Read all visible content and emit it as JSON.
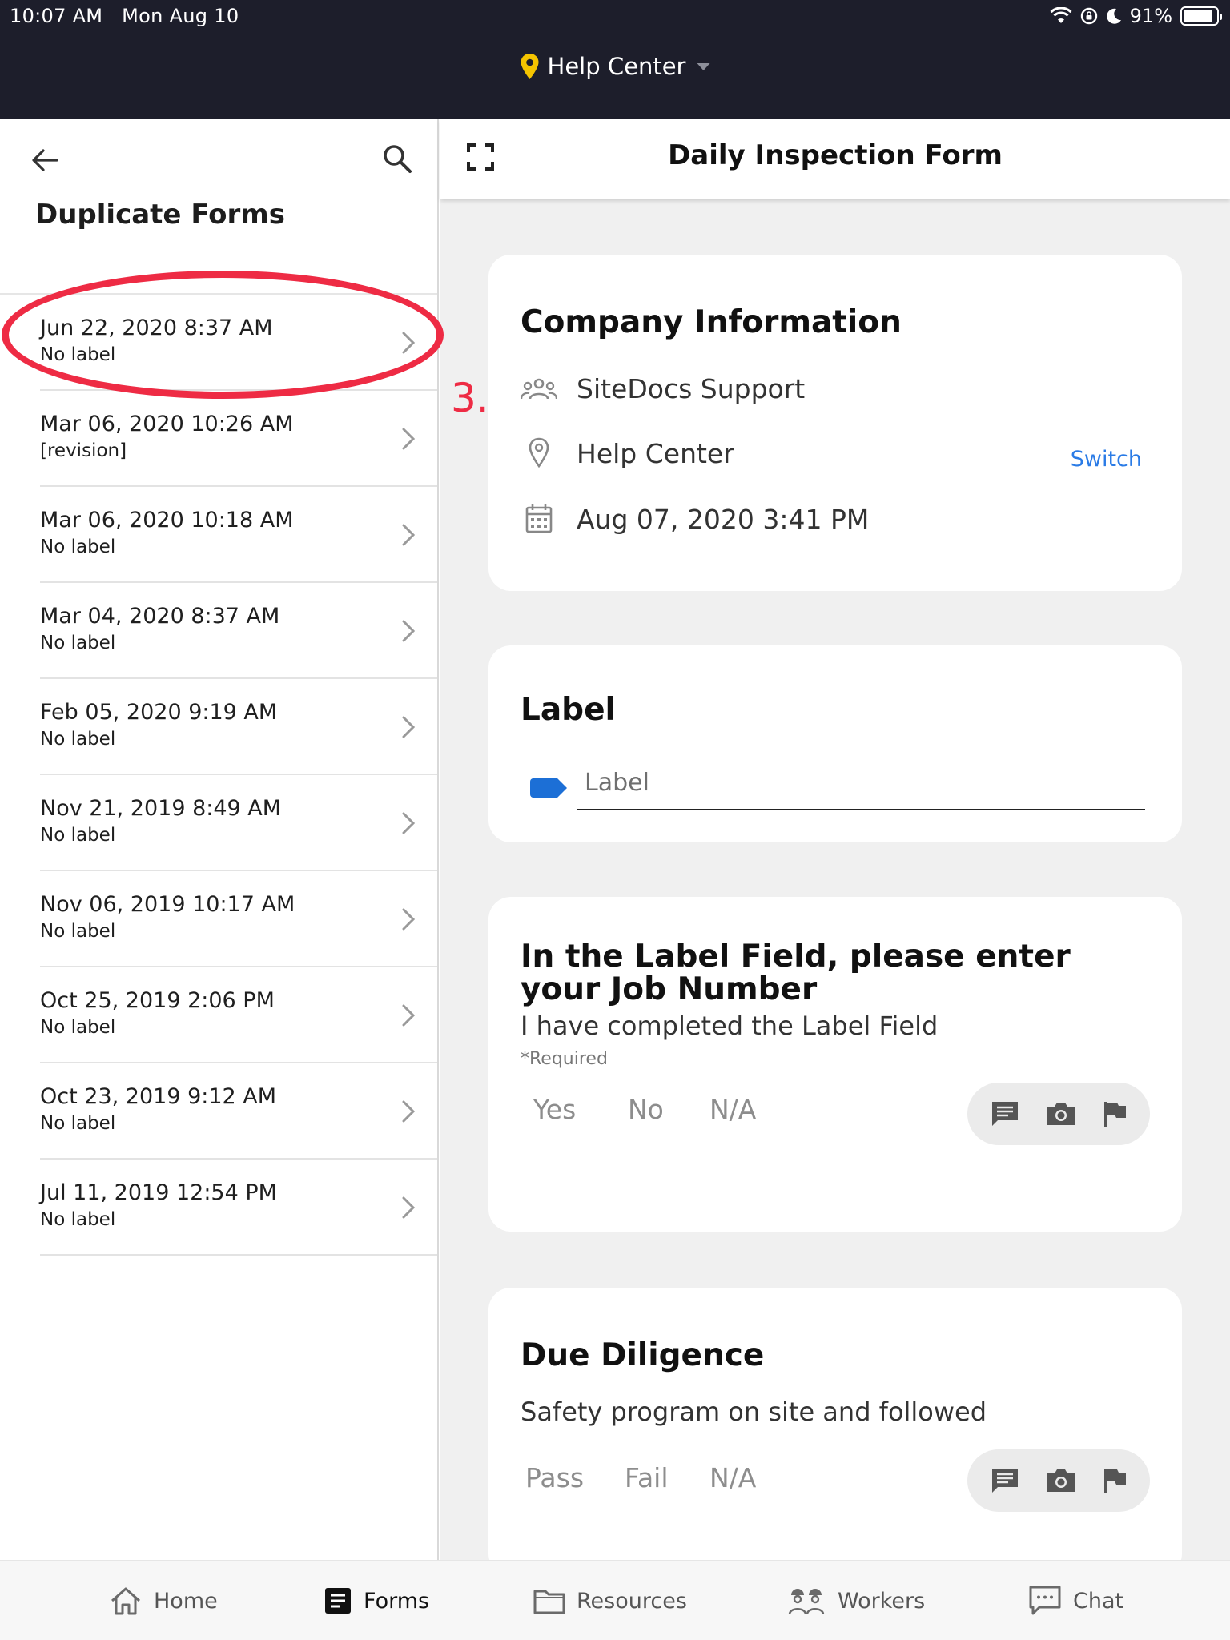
{
  "status_bar": {
    "time": "10:07 AM",
    "date": "Mon Aug 10",
    "battery": "91%",
    "battery_level": 0.91
  },
  "header": {
    "location": "Help Center",
    "location_icon": "pin-icon"
  },
  "left_panel": {
    "title": "Duplicate Forms",
    "items": [
      {
        "date": "Jun 22, 2020 8:37 AM",
        "label": "No label"
      },
      {
        "date": "Mar 06, 2020 10:26 AM",
        "label": "[revision]"
      },
      {
        "date": "Mar 06, 2020 10:18 AM",
        "label": "No label"
      },
      {
        "date": "Mar 04, 2020 8:37 AM",
        "label": "No label"
      },
      {
        "date": "Feb 05, 2020 9:19 AM",
        "label": "No label"
      },
      {
        "date": "Nov 21, 2019 8:49 AM",
        "label": "No label"
      },
      {
        "date": "Nov 06, 2019 10:17 AM",
        "label": "No label"
      },
      {
        "date": "Oct 25, 2019 2:06 PM",
        "label": "No label"
      },
      {
        "date": "Oct 23, 2019 9:12 AM",
        "label": "No label"
      },
      {
        "date": "Jul 11, 2019 12:54 PM",
        "label": "No label"
      }
    ]
  },
  "annotation": {
    "number": "3."
  },
  "form": {
    "title": "Daily Inspection Form",
    "company": {
      "heading": "Company Information",
      "organization": "SiteDocs Support",
      "location": "Help Center",
      "switch_label": "Switch",
      "datetime": "Aug 07, 2020 3:41 PM"
    },
    "label_section": {
      "heading": "Label",
      "placeholder": "Label"
    },
    "question1": {
      "title": "In the Label Field, please enter your Job Number",
      "subtitle": "I have completed the Label Field",
      "required": "*Required",
      "options": [
        "Yes",
        "No",
        "N/A"
      ]
    },
    "question2": {
      "title": "Due Diligence",
      "subtitle": "Safety program on site and followed",
      "options": [
        "Pass",
        "Fail",
        "N/A"
      ]
    }
  },
  "bottom_nav": {
    "items": [
      {
        "label": "Home",
        "icon": "home-icon"
      },
      {
        "label": "Forms",
        "icon": "forms-icon"
      },
      {
        "label": "Resources",
        "icon": "folder-icon"
      },
      {
        "label": "Workers",
        "icon": "workers-icon"
      },
      {
        "label": "Chat",
        "icon": "chat-icon"
      }
    ]
  },
  "colors": {
    "topbar": "#1d1e2b",
    "accent_blue": "#2a7be6",
    "tag_blue": "#1c6fd6",
    "annotation_red": "#ee2b44",
    "pin_yellow": "#f5c400"
  }
}
